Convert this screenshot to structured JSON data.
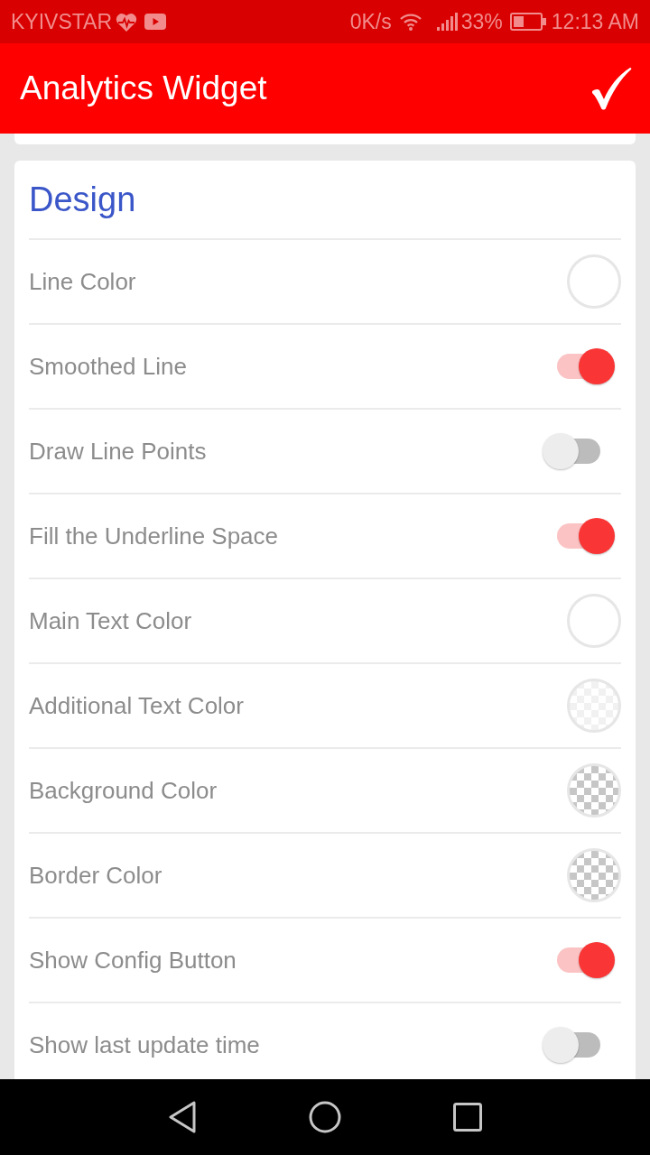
{
  "status_bar": {
    "carrier": "KYIVSTAR",
    "speed": "0K/s",
    "battery": "33%",
    "time": "12:13 AM"
  },
  "app_bar": {
    "title": "Analytics Widget"
  },
  "section": {
    "title": "Design",
    "rows": [
      {
        "kind": "swatch",
        "label": "Line Color"
      },
      {
        "kind": "switch",
        "label": "Smoothed Line",
        "on": true
      },
      {
        "kind": "switch",
        "label": "Draw Line Points",
        "on": false
      },
      {
        "kind": "switch",
        "label": "Fill the Underline Space",
        "on": true
      },
      {
        "kind": "swatch",
        "label": "Main Text Color"
      },
      {
        "kind": "translucent",
        "label": "Additional Text Color"
      },
      {
        "kind": "transparent",
        "label": "Background Color"
      },
      {
        "kind": "transparent",
        "label": "Border Color"
      },
      {
        "kind": "switch",
        "label": "Show Config Button",
        "on": true
      },
      {
        "kind": "switch",
        "label": "Show last update time",
        "on": false
      }
    ]
  }
}
